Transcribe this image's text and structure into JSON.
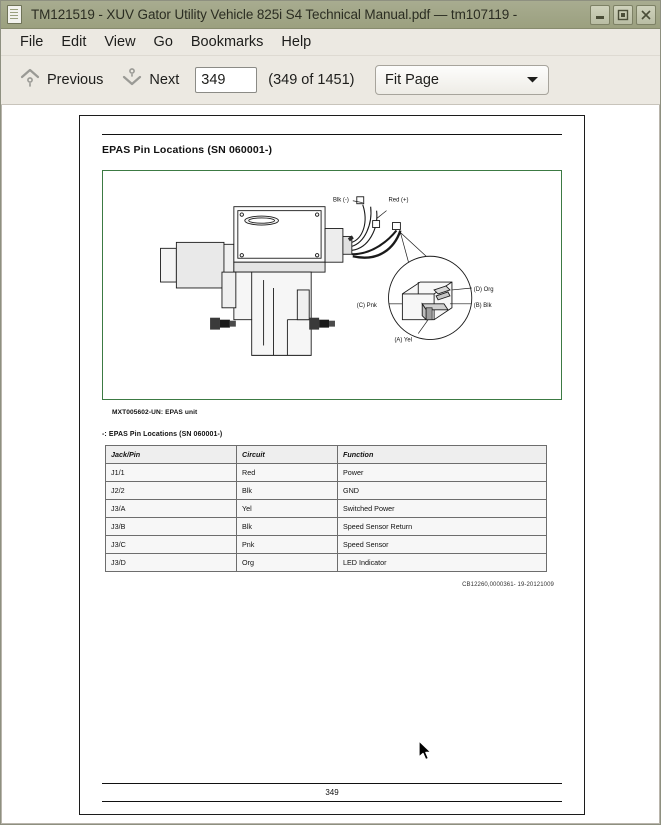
{
  "window": {
    "title": "TM121519 - XUV Gator Utility Vehicle 825i S4 Technical Manual.pdf — tm107119 -",
    "doc_icon": "document-icon",
    "buttons": {
      "minimize": "minimize-icon",
      "maximize": "maximize-icon",
      "close": "close-icon"
    }
  },
  "menubar": {
    "items": [
      {
        "label": "File"
      },
      {
        "label": "Edit"
      },
      {
        "label": "View"
      },
      {
        "label": "Go"
      },
      {
        "label": "Bookmarks"
      },
      {
        "label": "Help"
      }
    ]
  },
  "toolbar": {
    "previous_label": "Previous",
    "previous_icon": "chevron-up-icon",
    "next_label": "Next",
    "next_icon": "chevron-down-icon",
    "page_input_value": "349",
    "page_count_text": "(349 of 1451)",
    "zoom_value": "Fit Page",
    "zoom_dropdown_icon": "chevron-down-icon"
  },
  "document": {
    "section_heading": "EPAS Pin Locations (SN 060001-)",
    "figure": {
      "caption": "MXT005602-UN: EPAS unit",
      "border_color": "#3c7a43",
      "labels": {
        "black_negative": "Blk (-)",
        "red_positive": "Red (+)",
        "pin_d": "(D) Org",
        "pin_b": "(B) Blk",
        "pin_c": "(C) Pnk",
        "pin_a": "(A) Yel"
      }
    },
    "table_caption_marker": "-:",
    "table_caption": "EPAS Pin Locations (SN 060001-)",
    "table": {
      "headers": [
        "Jack/Pin",
        "Circuit",
        "Function"
      ],
      "rows": [
        [
          "J1/1",
          "Red",
          "Power"
        ],
        [
          "J2/2",
          "Blk",
          "GND"
        ],
        [
          "J3/A",
          "Yel",
          "Switched Power"
        ],
        [
          "J3/B",
          "Blk",
          "Speed Sensor Return"
        ],
        [
          "J3/C",
          "Pnk",
          "Speed Sensor"
        ],
        [
          "J3/D",
          "Org",
          "LED Indicator"
        ]
      ]
    },
    "doc_code": "CB12260,0000361- 19-20121009",
    "footer_page_number": "349"
  }
}
